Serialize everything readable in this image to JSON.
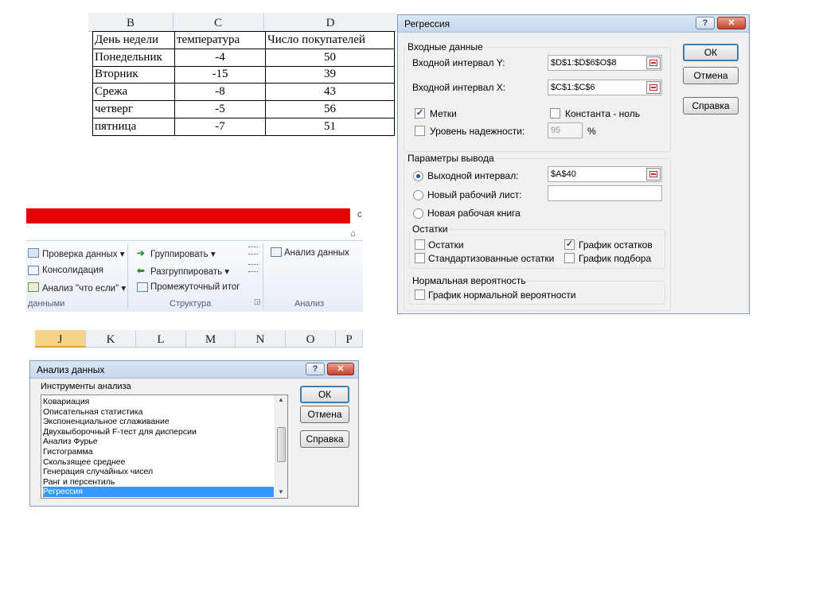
{
  "sheet": {
    "col_headers": [
      "B",
      "C",
      "D"
    ],
    "header_row": [
      "День недели",
      "температура",
      "Число покупателей"
    ],
    "rows": [
      [
        "Понедельник",
        "-4",
        "50"
      ],
      [
        "Вторник",
        "-15",
        "39"
      ],
      [
        "Срежа",
        "-8",
        "43"
      ],
      [
        "четверг",
        "-5",
        "56"
      ],
      [
        "пятница",
        "-7",
        "51"
      ]
    ]
  },
  "regression": {
    "title": "Регрессия",
    "help_glyph": "?",
    "close_glyph": "✕",
    "input_group": "Входные данные",
    "y_label": "Входной интервал Y:",
    "y_value": "$D$1:$D$6$O$8",
    "x_label": "Входной интервал X:",
    "x_value": "$C$1:$C$6",
    "labels_check": "Метки",
    "labels_checked": true,
    "const_check": "Константа - ноль",
    "conf_check": "Уровень надежности:",
    "conf_value": "95",
    "percent": "%",
    "output_group": "Параметры вывода",
    "out_range": "Выходной интервал:",
    "out_range_value": "$A$40",
    "new_sheet": "Новый рабочий лист:",
    "new_book": "Новая рабочая книга",
    "residuals_group": "Остатки",
    "residuals": "Остатки",
    "residual_plot": "График остатков",
    "residual_plot_checked": true,
    "std_residuals": "Стандартизованные остатки",
    "fit_plot": "График подбора",
    "normal_group": "Нормальная вероятность",
    "normal_plot": "График нормальной вероятности",
    "ok": "ОК",
    "cancel": "Отмена",
    "help": "Справка"
  },
  "ribbon": {
    "stub_top": "с",
    "stub_mid": "⌂",
    "data_validation": "Проверка данных",
    "consolidation": "Консолидация",
    "whatif": "Анализ \"что если\"",
    "group_data": "данными",
    "group_btn": "Группировать",
    "ungroup_btn": "Разгруппировать",
    "subtotal": "Промежуточный итог",
    "group_structure": "Структура",
    "analysis_btn": "Анализ данных",
    "group_analysis": "Анализ",
    "dropdown_glyph": "▾"
  },
  "columns": [
    "J",
    "K",
    "L",
    "M",
    "N",
    "O",
    "P"
  ],
  "analysis": {
    "title": "Анализ данных",
    "help_glyph": "?",
    "close_glyph": "✕",
    "tools_label": "Инструменты анализа",
    "items": [
      "Ковариация",
      "Описательная статистика",
      "Экспоненциальное сглаживание",
      "Двухвыборочный F-тест для дисперсии",
      "Анализ Фурье",
      "Гистограмма",
      "Скользящее среднее",
      "Генерация случайных чисел",
      "Ранг и персентиль",
      "Регрессия"
    ],
    "selected": "Регрессия",
    "ok": "ОК",
    "cancel": "Отмена",
    "help": "Справка"
  }
}
